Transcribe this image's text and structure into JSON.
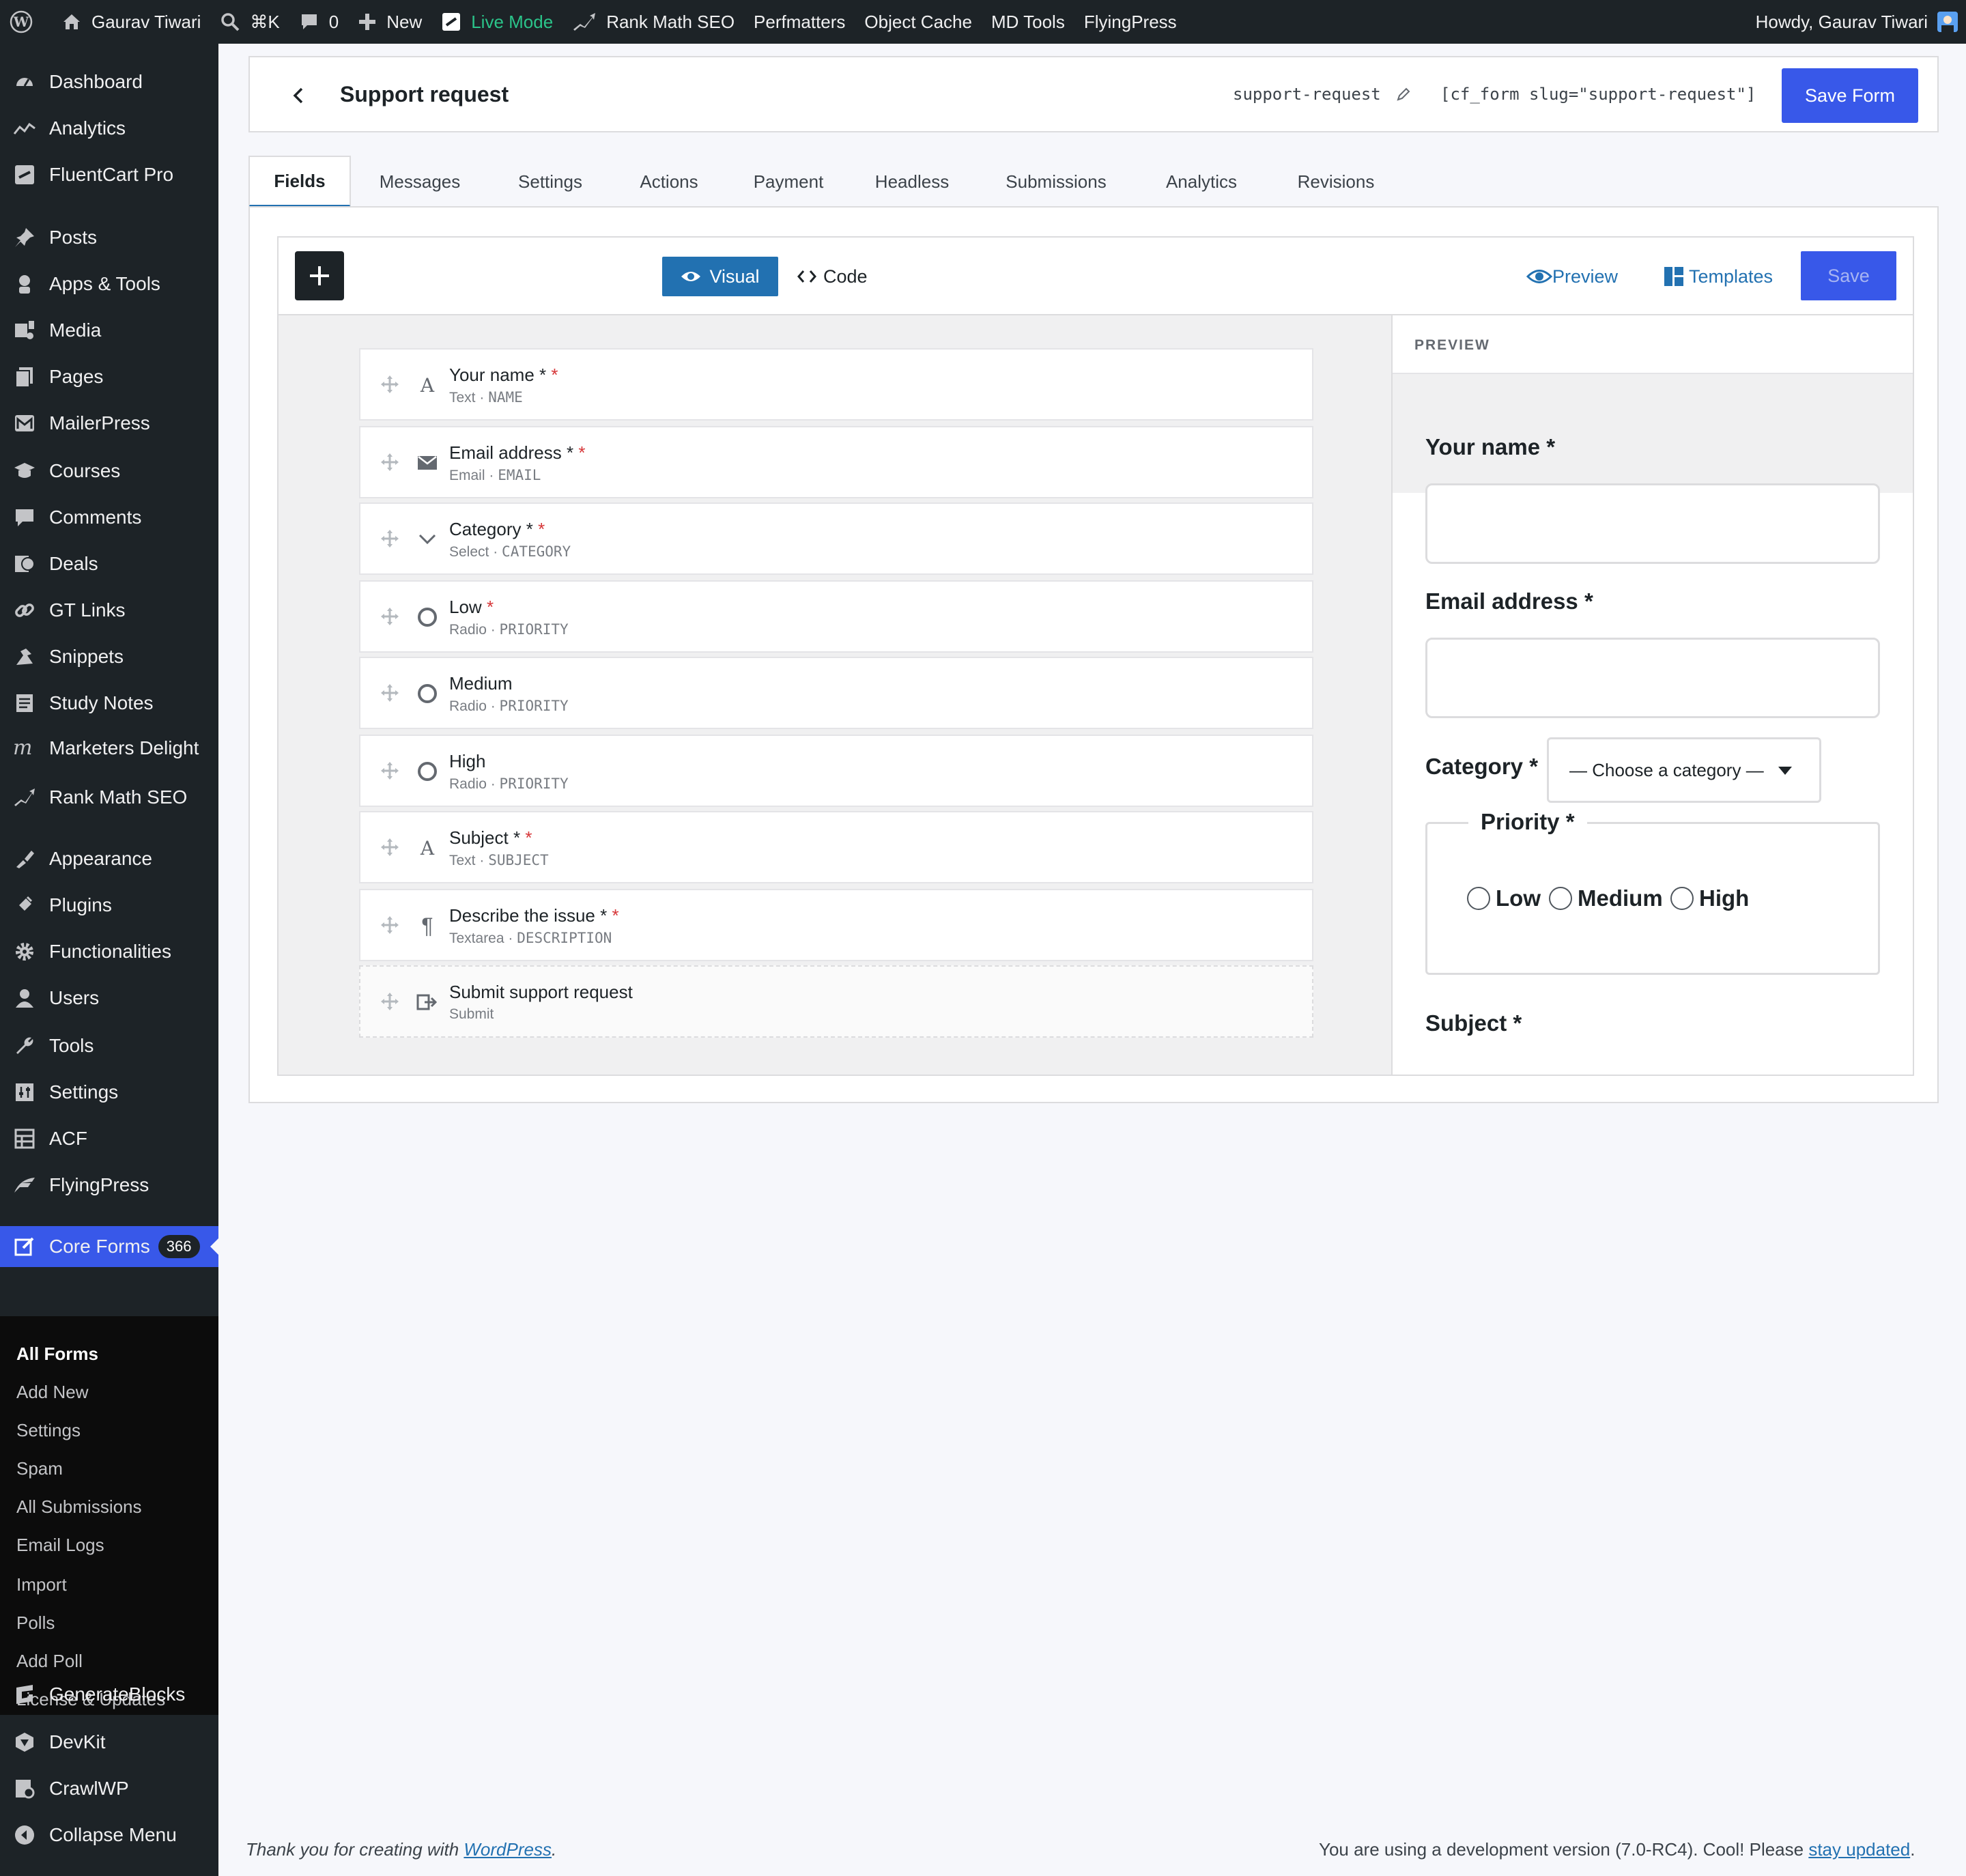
{
  "adminbar": {
    "site_name": "Gaurav Tiwari",
    "search_shortcut": "⌘K",
    "comments_count": "0",
    "new_label": "New",
    "live_mode": "Live Mode",
    "rank_math": "Rank Math SEO",
    "perfmatters": "Perfmatters",
    "object_cache": "Object Cache",
    "md_tools": "MD Tools",
    "flyingpress": "FlyingPress",
    "howdy": "Howdy, Gaurav Tiwari"
  },
  "sidebar": {
    "items": [
      {
        "label": "Dashboard",
        "icon": "dashboard-icon"
      },
      {
        "label": "Analytics",
        "icon": "analytics-icon"
      },
      {
        "label": "FluentCart Pro",
        "icon": "fluentcart-icon"
      },
      {
        "label": "Posts",
        "icon": "pin-icon"
      },
      {
        "label": "Apps & Tools",
        "icon": "apps-icon"
      },
      {
        "label": "Media",
        "icon": "media-icon"
      },
      {
        "label": "Pages",
        "icon": "pages-icon"
      },
      {
        "label": "MailerPress",
        "icon": "mailerpress-icon"
      },
      {
        "label": "Courses",
        "icon": "courses-icon"
      },
      {
        "label": "Comments",
        "icon": "comments-icon"
      },
      {
        "label": "Deals",
        "icon": "deals-icon"
      },
      {
        "label": "GT Links",
        "icon": "link-icon"
      },
      {
        "label": "Snippets",
        "icon": "snippets-icon"
      },
      {
        "label": "Study Notes",
        "icon": "notes-icon"
      },
      {
        "label": "Marketers Delight",
        "icon": "marketers-delight-icon"
      },
      {
        "label": "Rank Math SEO",
        "icon": "rank-math-icon"
      },
      {
        "label": "Appearance",
        "icon": "appearance-icon"
      },
      {
        "label": "Plugins",
        "icon": "plugins-icon"
      },
      {
        "label": "Functionalities",
        "icon": "gear-icon"
      },
      {
        "label": "Users",
        "icon": "users-icon"
      },
      {
        "label": "Tools",
        "icon": "wrench-icon"
      },
      {
        "label": "Settings",
        "icon": "settings-icon"
      },
      {
        "label": "ACF",
        "icon": "acf-icon"
      },
      {
        "label": "FlyingPress",
        "icon": "flyingpress-icon"
      },
      {
        "label": "Core Forms",
        "icon": "edit-form-icon",
        "badge": "366"
      },
      {
        "label": "GenerateBlocks",
        "icon": "generateblocks-icon"
      },
      {
        "label": "DevKit",
        "icon": "devkit-icon"
      },
      {
        "label": "CrawlWP",
        "icon": "crawlwp-icon"
      },
      {
        "label": "Collapse Menu",
        "icon": "collapse-icon"
      }
    ],
    "submenu": [
      "All Forms",
      "Add New",
      "Settings",
      "Spam",
      "All Submissions",
      "Email Logs",
      "Import",
      "Polls",
      "Add Poll",
      "License & Updates"
    ]
  },
  "header": {
    "title": "Support request",
    "slug": "support-request",
    "shortcode": "[cf_form slug=\"support-request\"]",
    "save_label": "Save Form"
  },
  "tabs": [
    "Fields",
    "Messages",
    "Settings",
    "Actions",
    "Payment",
    "Headless",
    "Submissions",
    "Analytics",
    "Revisions"
  ],
  "toolbar": {
    "visual": "Visual",
    "code": "Code",
    "preview": "Preview",
    "templates": "Templates",
    "save": "Save"
  },
  "fields": [
    {
      "label": "Your name *",
      "required": "*",
      "type": "Text",
      "key": "NAME",
      "icon": "text-icon"
    },
    {
      "label": "Email address *",
      "required": "*",
      "type": "Email",
      "key": "EMAIL",
      "icon": "email-icon"
    },
    {
      "label": "Category *",
      "required": "*",
      "type": "Select",
      "key": "CATEGORY",
      "icon": "chevron-down-icon"
    },
    {
      "label": "Low",
      "required": "*",
      "type": "Radio",
      "key": "PRIORITY",
      "icon": "radio-icon"
    },
    {
      "label": "Medium",
      "required": "",
      "type": "Radio",
      "key": "PRIORITY",
      "icon": "radio-icon"
    },
    {
      "label": "High",
      "required": "",
      "type": "Radio",
      "key": "PRIORITY",
      "icon": "radio-icon"
    },
    {
      "label": "Subject *",
      "required": "*",
      "type": "Text",
      "key": "SUBJECT",
      "icon": "text-icon"
    },
    {
      "label": "Describe the issue *",
      "required": "*",
      "type": "Textarea",
      "key": "DESCRIPTION",
      "icon": "paragraph-icon"
    },
    {
      "label": "Submit support request",
      "required": "",
      "type": "Submit",
      "key": "",
      "icon": "submit-icon"
    }
  ],
  "preview": {
    "heading": "PREVIEW",
    "name_label": "Your name *",
    "email_label": "Email address *",
    "category_label": "Category *",
    "category_placeholder": "— Choose a category —",
    "priority_legend": "Priority *",
    "options": [
      "Low",
      "Medium",
      "High"
    ],
    "subject_label": "Subject *"
  },
  "footer": {
    "thanks_prefix": "Thank you for creating with ",
    "wordpress_link": "WordPress",
    "thanks_suffix": ".",
    "version_text": "You are using a development version (7.0-RC4). Cool! Please ",
    "stay_updated": "stay updated",
    "version_suffix": "."
  },
  "colors": {
    "accent": "#3858e9",
    "wp_blue": "#2271b1",
    "admin_dark": "#1d2327",
    "live_green": "#2bc48a",
    "required_red": "#d63638"
  }
}
